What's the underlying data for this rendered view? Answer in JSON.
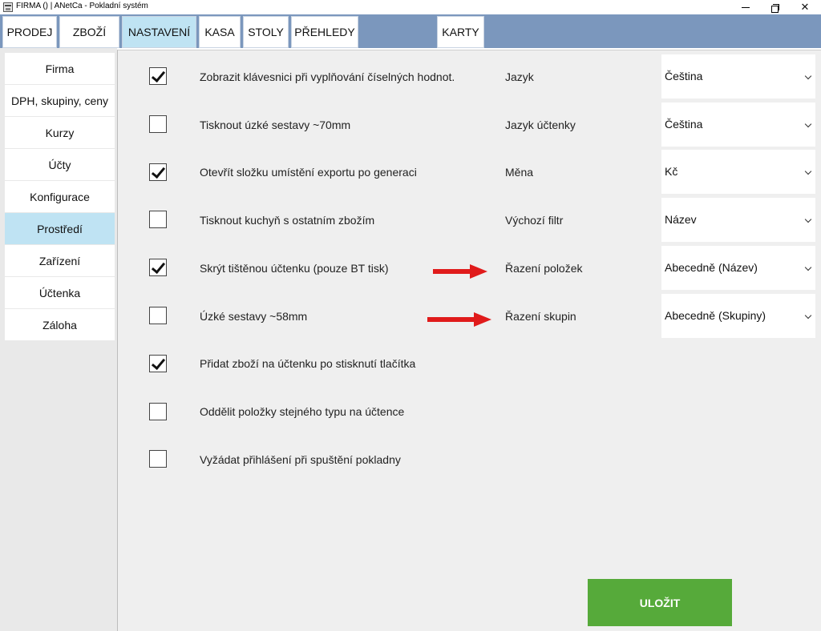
{
  "window": {
    "title": "FIRMA () | ANetCa - Pokladní systém",
    "icons": {
      "app": "cash-register-icon",
      "minimize": "minimize-icon",
      "maximize": "restore-icon",
      "close": "close-icon"
    },
    "close_glyph": "✕"
  },
  "topnav": {
    "tabs": [
      "PRODEJ",
      "ZBOŽÍ",
      "NASTAVENÍ",
      "KASA",
      "STOLY",
      "PŘEHLEDY",
      "KARTY"
    ],
    "active": "NASTAVENÍ"
  },
  "sidebar": {
    "items": [
      "Firma",
      "DPH, skupiny, ceny",
      "Kurzy",
      "Účty",
      "Konfigurace",
      "Prostředí",
      "Zařízení",
      "Účtenka",
      "Záloha"
    ],
    "active": "Prostředí"
  },
  "options": [
    {
      "label": "Zobrazit klávesnici při vyplňování číselných hodnot.",
      "checked": true
    },
    {
      "label": "Tisknout úzké sestavy ~70mm",
      "checked": false
    },
    {
      "label": "Otevřít složku umístění exportu po generaci",
      "checked": true
    },
    {
      "label": "Tisknout kuchyň s ostatním zbožím",
      "checked": false
    },
    {
      "label": "Skrýt tištěnou účtenku (pouze BT tisk)",
      "checked": true
    },
    {
      "label": "Úzké sestavy ~58mm",
      "checked": false
    },
    {
      "label": "Přidat zboží na účtenku po stisknutí tlačítka",
      "checked": true
    },
    {
      "label": "Oddělit položky stejného typu na účtence",
      "checked": false
    },
    {
      "label": "Vyžádat přihlášení při spuštění pokladny",
      "checked": false
    }
  ],
  "settings": [
    {
      "label": "Jazyk",
      "value": "Čeština"
    },
    {
      "label": "Jazyk účtenky",
      "value": "Čeština"
    },
    {
      "label": "Měna",
      "value": "Kč"
    },
    {
      "label": "Výchozí filtr",
      "value": "Název"
    },
    {
      "label": "Řazení položek",
      "value": "Abecedně (Název)"
    },
    {
      "label": "Řazení skupin",
      "value": "Abecedně (Skupiny)"
    }
  ],
  "annotations": {
    "arrow_color": "#e01b1b"
  },
  "colors": {
    "nav_bg": "#7b97bd",
    "active_bg": "#bfe3f3",
    "save_bg": "#56aa3a"
  },
  "save_label": "ULOŽIT"
}
